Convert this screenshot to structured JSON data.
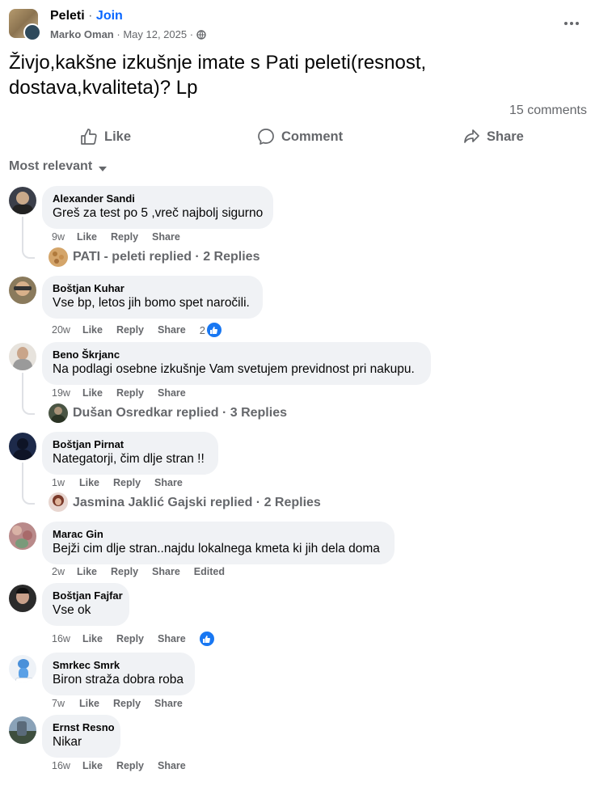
{
  "post": {
    "group_name": "Peleti",
    "join_label": "Join",
    "author": "Marko Oman",
    "date": "May 12, 2025",
    "text_line1": "Živjo,kakšne izkušnje imate s Pati peleti(resnost,",
    "text_line2": "dostava,kvaliteta)? Lp",
    "comment_count": "15 comments"
  },
  "actions": {
    "like": "Like",
    "comment": "Comment",
    "share": "Share"
  },
  "sort_label": "Most relevant",
  "comments": [
    {
      "name": "Alexander Sandi",
      "text": "Greš za test po 5 ,vreč najbolj sigurno",
      "time": "9w",
      "like": "Like",
      "reply": "Reply",
      "share": "Share",
      "replies": "PATI - peleti replied · 2 Replies",
      "avatar_color": "#3b3f4a"
    },
    {
      "name": "Boštjan Kuhar",
      "text": "Vse bp, letos jih bomo spet naročili.",
      "time": "20w",
      "like": "Like",
      "reply": "Reply",
      "share": "Share",
      "reactions": "2",
      "avatar_color": "#8a7a5c"
    },
    {
      "name": "Beno Škrjanc",
      "text": "Na podlagi osebne izkušnje Vam svetujem previdnost pri nakupu.",
      "time": "19w",
      "like": "Like",
      "reply": "Reply",
      "share": "Share",
      "replies": "Dušan Osredkar replied · 3 Replies",
      "avatar_color": "#c9c2b8"
    },
    {
      "name": "Boštjan Pirnat",
      "text": "Nategatorji, čim dlje stran !!",
      "time": "1w",
      "like": "Like",
      "reply": "Reply",
      "share": "Share",
      "replies": "Jasmina Jaklić Gajski replied · 2 Replies",
      "avatar_color": "#1d2a4a"
    },
    {
      "name": "Marac Gin",
      "text": "Bejži cim dlje stran..najdu lokalnega kmeta ki jih dela doma",
      "time": "2w",
      "like": "Like",
      "reply": "Reply",
      "share": "Share",
      "edited": "Edited",
      "avatar_color": "#b98a8a"
    },
    {
      "name": "Boštjan Fajfar",
      "text": "Vse ok",
      "time": "16w",
      "like": "Like",
      "reply": "Reply",
      "share": "Share",
      "avatar_color": "#2b2b2b"
    },
    {
      "name": "Smrkec Smrk",
      "text": "Biron straža dobra roba",
      "time": "7w",
      "like": "Like",
      "reply": "Reply",
      "share": "Share",
      "avatar_color": "#e8eef6"
    },
    {
      "name": "Ernst Resno",
      "text": "Nikar",
      "time": "16w",
      "like": "Like",
      "reply": "Reply",
      "share": "Share",
      "avatar_color": "#4a5a6a"
    }
  ],
  "colors": {
    "link_blue": "#0866ff",
    "meta_gray": "#65676b",
    "bubble": "#f0f2f5",
    "like_blue": "#1877f2"
  }
}
